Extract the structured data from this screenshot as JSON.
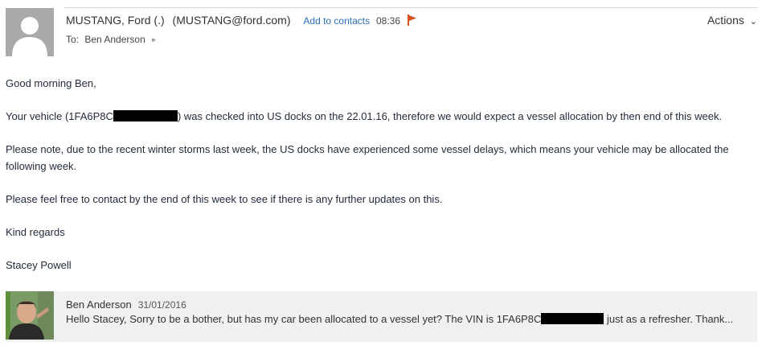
{
  "message": {
    "sender_name": "MUSTANG, Ford (.)",
    "sender_email": "(MUSTANG@ford.com)",
    "add_contacts_label": "Add to contacts",
    "time": "08:36",
    "flag_icon": "flag-icon",
    "to_label": "To:",
    "to_value": "Ben Anderson",
    "actions_label": "Actions",
    "flag_color": "#d9531e"
  },
  "body": {
    "greeting": "Good morning Ben,",
    "p1_before": "Your vehicle (1FA6P8C",
    "p1_after": ") was checked into US docks on the 22.01.16, therefore we would expect a vessel allocation by then end of this week.",
    "p2": "Please note, due to the recent winter storms last week, the US docks have experienced some vessel delays, which means your vehicle may be allocated the following week.",
    "p3": "Please feel free to contact by the end of this week to see if there is any further updates on this.",
    "closing": "Kind regards",
    "signature": "Stacey Powell"
  },
  "reply": {
    "name": "Ben Anderson",
    "date": "31/01/2016",
    "preview_before": "Hello Stacey, Sorry to be a bother, but has my car been allocated to a vessel yet? The VIN is 1FA6P8C",
    "preview_after": " just as a refresher. Thank..."
  }
}
